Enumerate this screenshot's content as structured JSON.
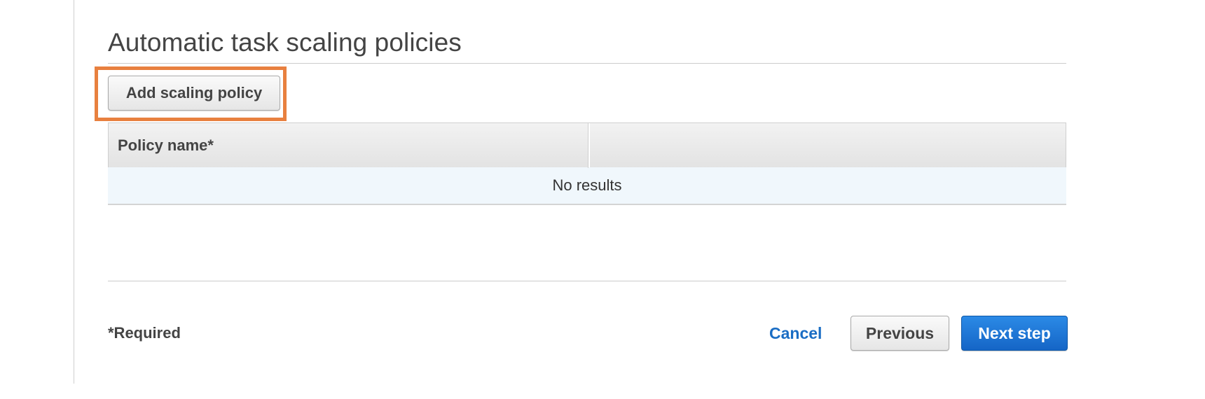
{
  "section": {
    "title": "Automatic task scaling policies",
    "add_button_label": "Add scaling policy"
  },
  "table": {
    "columns": [
      "Policy name*",
      ""
    ],
    "empty_message": "No results"
  },
  "footer": {
    "required_note": "*Required",
    "cancel_label": "Cancel",
    "previous_label": "Previous",
    "next_label": "Next step"
  },
  "colors": {
    "highlight": "#e8803f",
    "primary": "#1565c6",
    "link": "#1a6dc4",
    "empty_row_bg": "#f0f7fc"
  }
}
